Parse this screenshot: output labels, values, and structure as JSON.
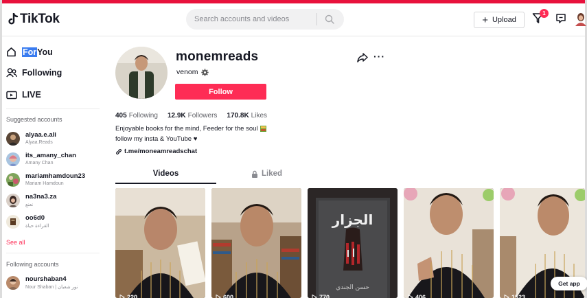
{
  "header": {
    "logo_text": "TikTok",
    "search_placeholder": "Search accounts and videos",
    "upload_label": "Upload",
    "inbox_badge": "1"
  },
  "sidebar": {
    "nav": [
      {
        "label_hl": "For",
        "label_rest": " You"
      },
      {
        "label": "Following"
      },
      {
        "label": "LIVE"
      }
    ],
    "suggested_title": "Suggested accounts",
    "suggested": [
      {
        "username": "alyaa.e.ali",
        "display": "Alyaa.Reads"
      },
      {
        "username": "its_amany_chan",
        "display": "Amany Chan"
      },
      {
        "username": "mariamhamdoun23",
        "display": "Mariam Hamdoun"
      },
      {
        "username": "na3na3.za",
        "display": "نعنع"
      },
      {
        "username": "oo6d0",
        "display": "القراءة حياة"
      }
    ],
    "see_all": "See all",
    "following_title": "Following accounts",
    "following": [
      {
        "username": "nourshaban4",
        "display": "Nour Shaban | نور شعبان"
      }
    ]
  },
  "profile": {
    "username": "monemreads",
    "nickname": "venom",
    "follow_label": "Follow",
    "stats": {
      "following_count": "405",
      "following_label": "Following",
      "followers_count": "12.9K",
      "followers_label": "Followers",
      "likes_count": "170.8K",
      "likes_label": "Likes"
    },
    "bio_line1": "Enjoyable books for the mind, Feeder for the soul",
    "bio_line2": "follow my insta & YouTube ♥",
    "link": "t.me/moneamreadschat"
  },
  "tabs": {
    "videos": "Videos",
    "liked": "Liked"
  },
  "videos": [
    {
      "views": "220"
    },
    {
      "views": "600"
    },
    {
      "views": "770",
      "cover_title": "الجزار",
      "cover_author": "حسن الجندي"
    },
    {
      "views": "406"
    },
    {
      "views": "1523"
    }
  ],
  "get_app": "Get app",
  "colors": {
    "brand": "#fe2c55",
    "text": "#161823",
    "secondary": "#8a8b91"
  }
}
